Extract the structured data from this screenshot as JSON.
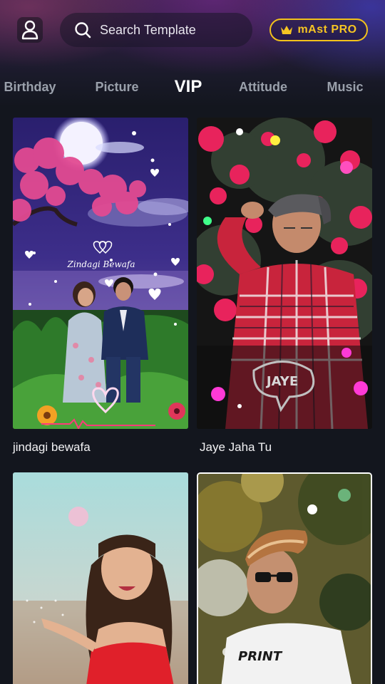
{
  "header": {
    "search_placeholder": "Search Template",
    "pro_label": "mAst PRO",
    "icons": {
      "profile": "person-icon",
      "search": "search-icon",
      "crown": "crown-icon"
    },
    "colors": {
      "pro_accent": "#f2c21b",
      "background": "#13161e"
    }
  },
  "tabs": [
    {
      "label": "Birthday",
      "active": false
    },
    {
      "label": "Picture",
      "active": false
    },
    {
      "label": "VIP",
      "active": true
    },
    {
      "label": "Attitude",
      "active": false
    },
    {
      "label": "Music",
      "active": false
    }
  ],
  "templates": [
    {
      "title": "jindagi bewafa",
      "overlay_text": "Zindagi Bewafa"
    },
    {
      "title": "Jaye Jaha Tu",
      "overlay_text": "JAYE"
    },
    {
      "title": ""
    },
    {
      "title": "",
      "overlay_text": "PRINT"
    }
  ]
}
